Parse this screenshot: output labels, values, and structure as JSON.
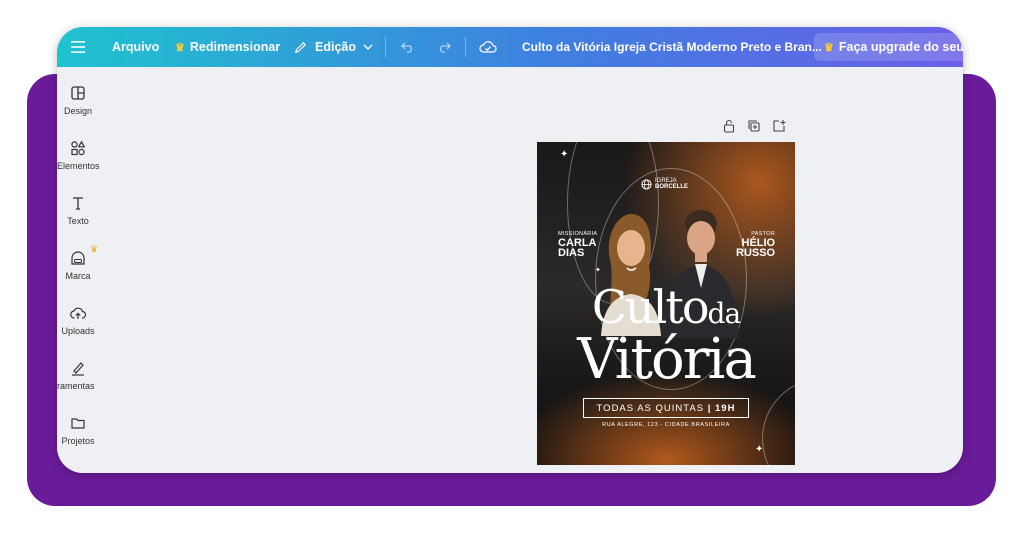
{
  "topbar": {
    "menu_icon": "hamburger-icon",
    "file_label": "Arquivo",
    "resize_label": "Redimensionar",
    "edit_label": "Edição",
    "document_title": "Culto da Vitória Igreja Cristã Moderno Preto e Bran...",
    "upgrade_label": "Faça upgrade do seu..."
  },
  "sidebar": {
    "items": [
      {
        "label": "Design",
        "icon": "layout-icon"
      },
      {
        "label": "Elementos",
        "icon": "shapes-icon"
      },
      {
        "label": "Texto",
        "icon": "text-icon"
      },
      {
        "label": "Marca",
        "icon": "brand-icon"
      },
      {
        "label": "Uploads",
        "icon": "cloud-upload-icon"
      },
      {
        "label": "Ferramentas",
        "icon": "draw-icon"
      },
      {
        "label": "Projetos",
        "icon": "folder-icon"
      }
    ]
  },
  "design": {
    "brand_line1": "IGREJA",
    "brand_line2": "BORCELLE",
    "left_role": "MISSIONÁRIA",
    "left_name1": "CARLA",
    "left_name2": "DIAS",
    "right_role": "PASTOR",
    "right_name1": "HÉLIO",
    "right_name2": "RUSSO",
    "title_word1": "Culto",
    "title_word2": "da",
    "title_word3": "Vitória",
    "schedule_text": "TODAS AS QUINTAS",
    "schedule_time": "| 19H",
    "address": "RUA ALEGRE, 123 - CIDADE BRASILEIRA"
  },
  "colors": {
    "frame": "#6a1b9a",
    "topbar_start": "#1fc3cf",
    "topbar_end": "#6a5fe8",
    "crown": "#ffc93c",
    "poster_accent": "#c4621e"
  }
}
